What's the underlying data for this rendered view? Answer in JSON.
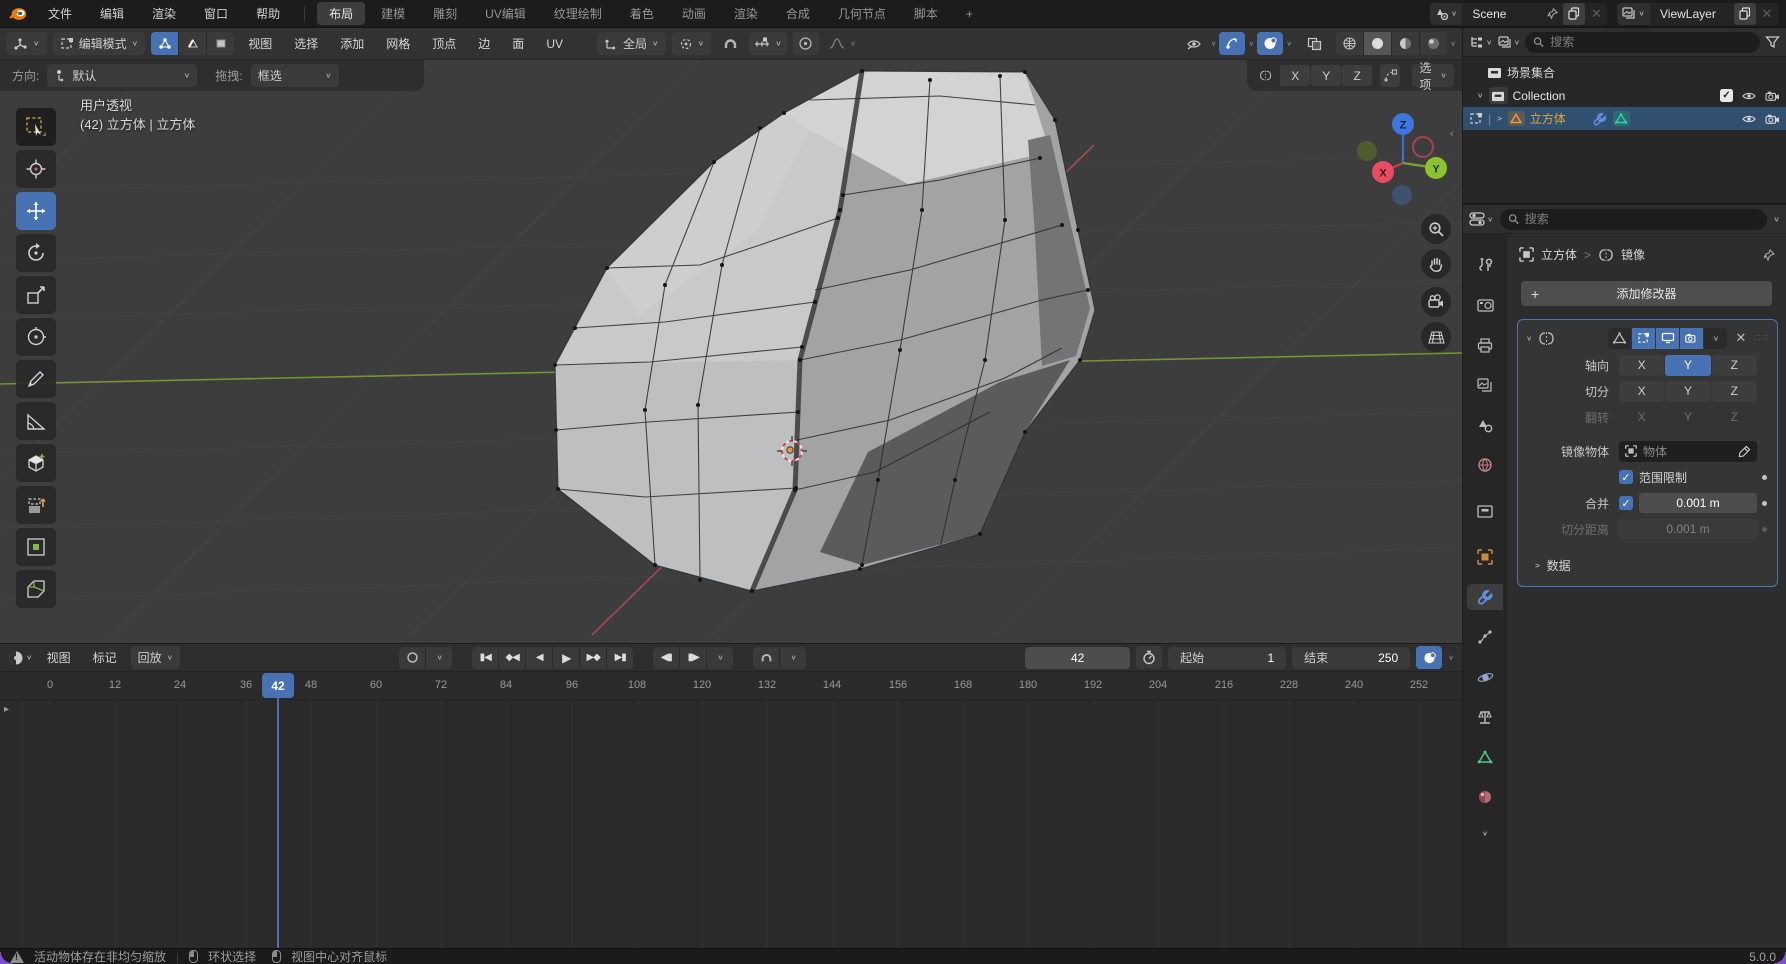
{
  "colors": {
    "accent": "#4772b3",
    "object_orange": "#e2a33c",
    "axis_x": "#b04a50",
    "axis_y": "#6d9532",
    "selection_row": "#31506f"
  },
  "topbar": {
    "menus": [
      "文件",
      "编辑",
      "渲染",
      "窗口",
      "帮助"
    ],
    "workspaces": [
      "布局",
      "建模",
      "雕刻",
      "UV编辑",
      "纹理绘制",
      "着色",
      "动画",
      "渲染",
      "合成",
      "几何节点",
      "脚本",
      "+"
    ],
    "active_workspace": "布局",
    "scene_label": "Scene",
    "viewlayer_label": "ViewLayer"
  },
  "viewport": {
    "header": {
      "mode": "编辑模式",
      "menus": [
        "视图",
        "选择",
        "添加",
        "网格",
        "顶点",
        "边",
        "面",
        "UV"
      ],
      "orientation": "全局"
    },
    "tool_settings": {
      "direction_label": "方向:",
      "direction_value": "默认",
      "drag_label": "拖拽:",
      "drag_value": "框选",
      "axes": [
        "X",
        "Y",
        "Z"
      ],
      "options_label": "选项"
    },
    "overlay": {
      "line1": "用户透视",
      "line2": "(42) 立方体 | 立方体"
    },
    "gizmo": {
      "x": "X",
      "y": "Y",
      "z": "Z"
    },
    "tools": [
      "select-box",
      "cursor-3d",
      "move",
      "rotate",
      "scale",
      "transform",
      "annotate",
      "measure",
      "add-cube",
      "extrude-region",
      "inset-faces",
      "bevel"
    ],
    "active_tool": "move"
  },
  "timeline": {
    "menus": [
      "视图",
      "标记"
    ],
    "playback_label": "回放",
    "frame_field": "42",
    "start_label": "起始",
    "start_value": "1",
    "end_label": "结束",
    "end_value": "250",
    "current_frame": "42",
    "ruler": [
      "0",
      "12",
      "24",
      "36",
      "48",
      "60",
      "72",
      "84",
      "96",
      "108",
      "120",
      "132",
      "144",
      "156",
      "168",
      "180",
      "192",
      "204",
      "216",
      "228",
      "240",
      "252"
    ]
  },
  "outliner": {
    "search_placeholder": "搜索",
    "scene_collection_label": "场景集合",
    "collection_label": "Collection",
    "object_label": "立方体"
  },
  "properties": {
    "search_placeholder": "搜索",
    "breadcrumb_object": "立方体",
    "breadcrumb_separator": ">",
    "breadcrumb_modifier": "镜像",
    "add_modifier_label": "添加修改器",
    "modifier": {
      "axis_label": "轴向",
      "bisect_label": "切分",
      "flip_label": "翻转",
      "axes": [
        "X",
        "Y",
        "Z"
      ],
      "active_axis": "Y",
      "mirror_object_label": "镜像物体",
      "mirror_object_placeholder": "物体",
      "clipping_label": "范围限制",
      "merge_label": "合并",
      "merge_value": "0.001 m",
      "bisect_distance_label": "切分距离",
      "bisect_distance_value": "0.001 m",
      "data_label": "数据"
    }
  },
  "statusbar": {
    "warning": "活动物体存在非均匀缩放",
    "hint_ring": "环状选择",
    "hint_center": "视图中心对齐鼠标",
    "version": "5.0.0"
  }
}
